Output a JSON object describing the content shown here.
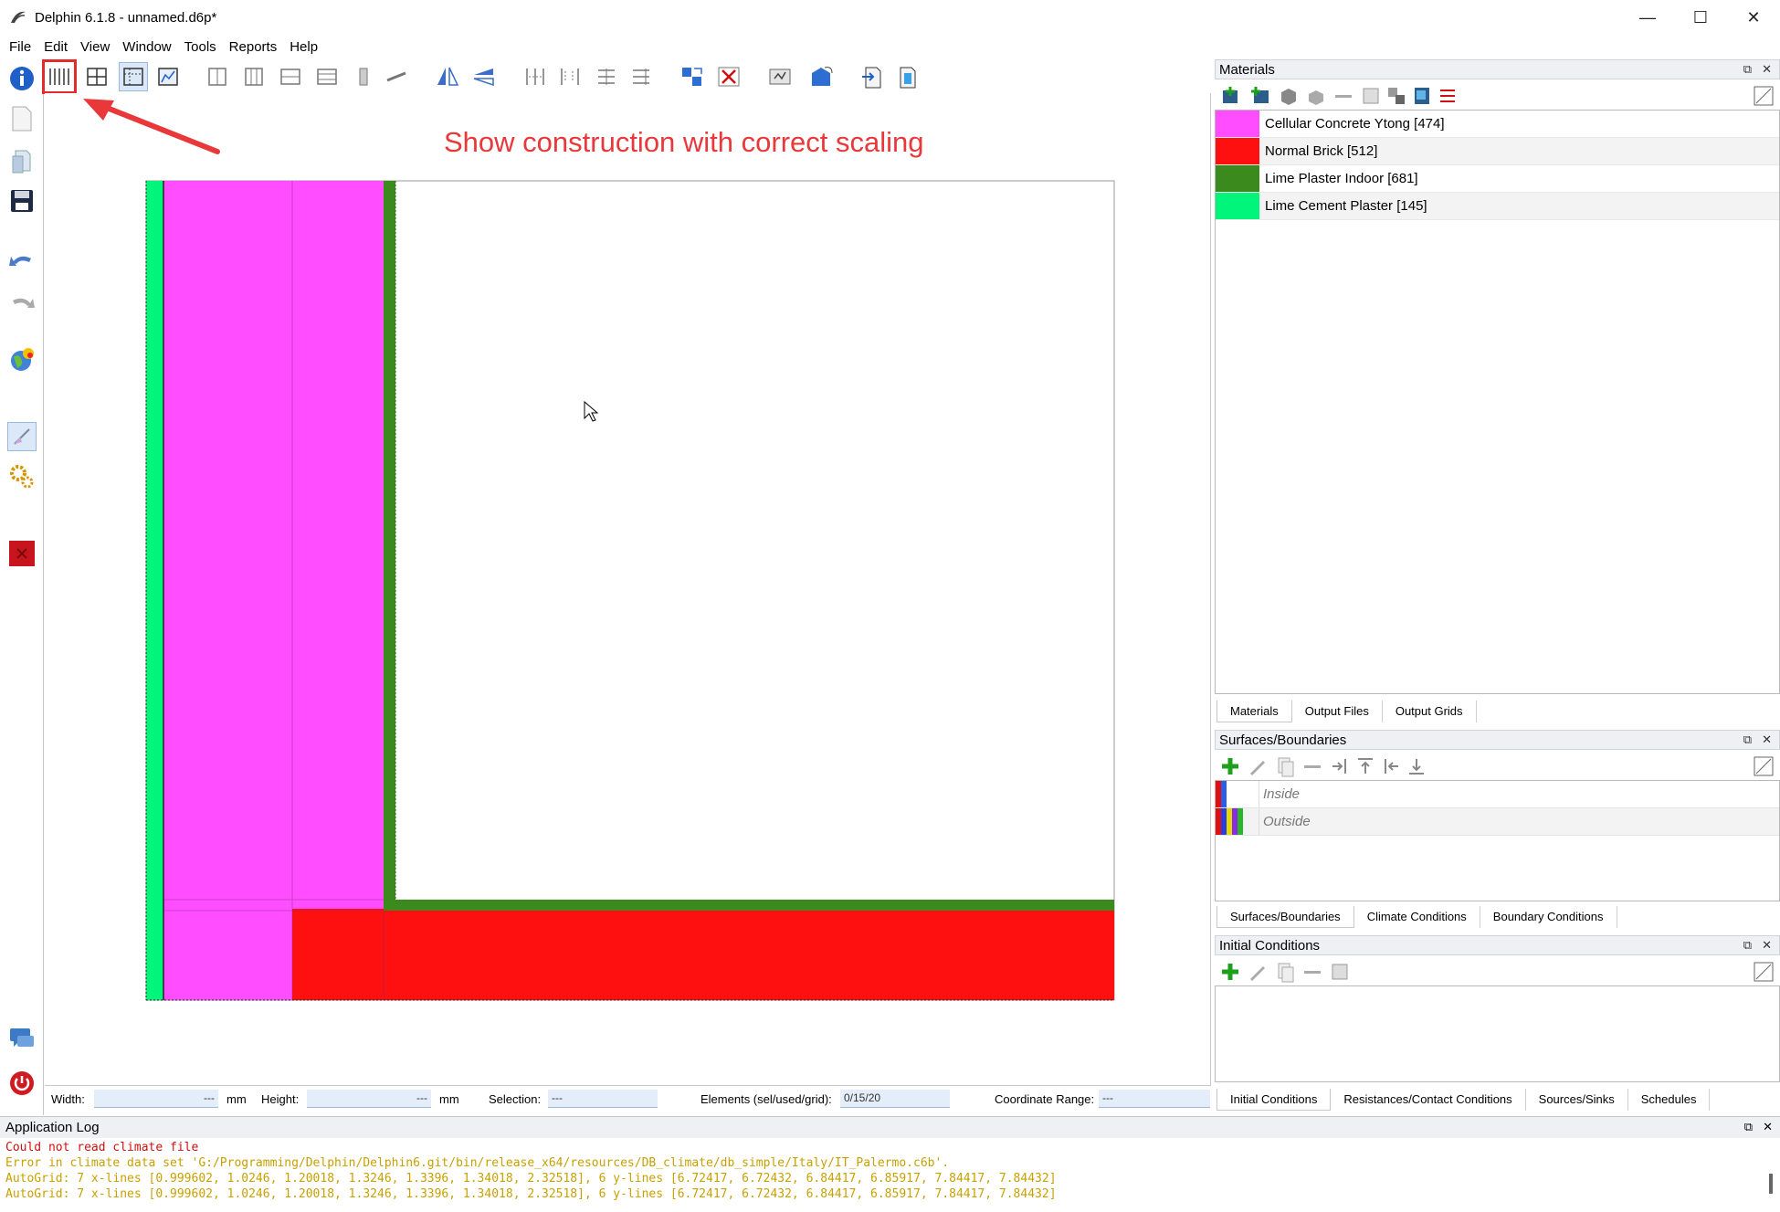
{
  "window": {
    "title": "Delphin 6.1.8 - unnamed.d6p*",
    "minimize": "—",
    "maximize": "☐",
    "close": "✕"
  },
  "menu": [
    "File",
    "Edit",
    "View",
    "Window",
    "Tools",
    "Reports",
    "Help"
  ],
  "annotation": "Show construction with correct scaling",
  "status": {
    "width_label": "Width:",
    "width_value": "---",
    "width_unit": "mm",
    "height_label": "Height:",
    "height_value": "---",
    "height_unit": "mm",
    "selection_label": "Selection:",
    "selection_value": "---",
    "elements_label": "Elements (sel/used/grid):",
    "elements_value": "0/15/20",
    "coord_label": "Coordinate Range:",
    "coord_value": "---"
  },
  "materials": {
    "title": "Materials",
    "items": [
      {
        "label": "Cellular Concrete Ytong [474]",
        "color": "#ff4dff"
      },
      {
        "label": "Normal Brick [512]",
        "color": "#ff1010"
      },
      {
        "label": "Lime Plaster Indoor [681]",
        "color": "#3a8a1e"
      },
      {
        "label": "Lime Cement Plaster [145]",
        "color": "#00f57a"
      }
    ],
    "tabs": [
      "Materials",
      "Output Files",
      "Output Grids"
    ]
  },
  "surfaces": {
    "title": "Surfaces/Boundaries",
    "items": [
      {
        "label": "Inside",
        "colors": [
          "#e01010",
          "#2a5ee8"
        ]
      },
      {
        "label": "Outside",
        "colors": [
          "#e01010",
          "#2a3ee0",
          "#e6d800",
          "#8a2be2",
          "#2ab52a"
        ]
      }
    ],
    "tabs": [
      "Surfaces/Boundaries",
      "Climate Conditions",
      "Boundary Conditions"
    ]
  },
  "initial": {
    "title": "Initial Conditions",
    "tabs": [
      "Initial Conditions",
      "Resistances/Contact Conditions",
      "Sources/Sinks",
      "Schedules"
    ]
  },
  "log": {
    "title": "Application Log",
    "lines": [
      {
        "text": "Could not read climate file",
        "kind": "err"
      },
      {
        "text": "Error in climate data set 'G:/Programming/Delphin/Delphin6.git/bin/release_x64/resources/DB_climate/db_simple/Italy/IT_Palermo.c6b'.",
        "kind": "warn"
      },
      {
        "text": "AutoGrid: 7 x-lines [0.999602, 1.0246, 1.20018, 1.3246, 1.3396, 1.34018, 2.32518], 6 y-lines [6.72417, 6.72432, 6.84417, 6.85917, 7.84417, 7.84432]",
        "kind": "info"
      },
      {
        "text": "AutoGrid: 7 x-lines [0.999602, 1.0246, 1.20018, 1.3246, 1.3396, 1.34018, 2.32518], 6 y-lines [6.72417, 6.72432, 6.84417, 6.85917, 7.84417, 7.84432]",
        "kind": "info"
      }
    ]
  }
}
